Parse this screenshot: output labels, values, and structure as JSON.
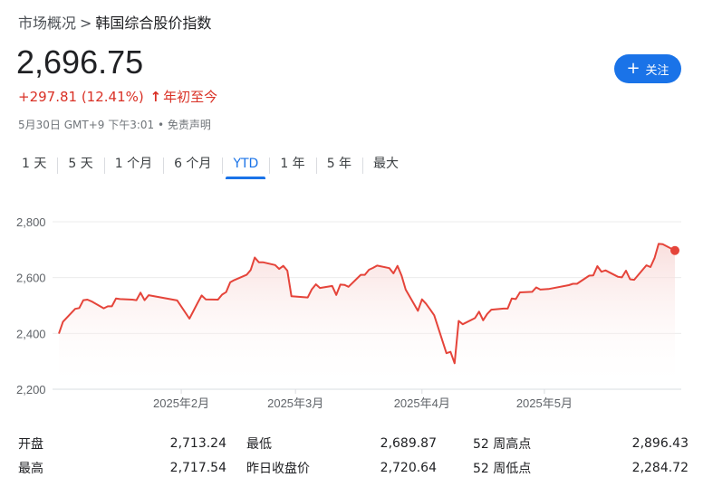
{
  "breadcrumb": {
    "parent": "市场概况",
    "separator": ">",
    "current": "韩国综合股价指数"
  },
  "price": "2,696.75",
  "change": {
    "text": "+297.81 (12.41%)",
    "arrow": "↑",
    "period": "年初至今",
    "color": "#d93025"
  },
  "meta": "5月30日 GMT+9 下午3:01 • 免责声明",
  "follow_button": {
    "icon": "plus-icon",
    "label": "关注",
    "color": "#1a73e8"
  },
  "range_tabs": [
    {
      "label": "1 天",
      "active": false
    },
    {
      "label": "5 天",
      "active": false
    },
    {
      "label": "1 个月",
      "active": false
    },
    {
      "label": "6 个月",
      "active": false
    },
    {
      "label": "YTD",
      "active": true
    },
    {
      "label": "1 年",
      "active": false
    },
    {
      "label": "5 年",
      "active": false
    },
    {
      "label": "最大",
      "active": false
    }
  ],
  "chart_data": {
    "type": "area",
    "x_tick_labels": [
      "2025年2月",
      "2025年3月",
      "2025年4月",
      "2025年5月"
    ],
    "y_ticks": [
      2200,
      2400,
      2600,
      2800
    ],
    "y_tick_labels": [
      "2,200",
      "2,400",
      "2,600",
      "2,800"
    ],
    "ylim": [
      2200,
      2800
    ],
    "x_range": [
      "2025-01-02",
      "2025-06-02"
    ],
    "grid": true,
    "line_color": "#e5443a",
    "fill_color": "#f7d4d2",
    "series": [
      {
        "x": [
          "2025-01-02",
          "2025-01-03",
          "2025-01-06",
          "2025-01-07",
          "2025-01-08",
          "2025-01-09",
          "2025-01-10",
          "2025-01-13",
          "2025-01-14",
          "2025-01-15",
          "2025-01-16",
          "2025-01-17",
          "2025-01-20",
          "2025-01-21",
          "2025-01-22",
          "2025-01-23",
          "2025-01-24",
          "2025-01-31",
          "2025-02-03",
          "2025-02-04",
          "2025-02-05",
          "2025-02-06",
          "2025-02-07",
          "2025-02-10",
          "2025-02-11",
          "2025-02-12",
          "2025-02-13",
          "2025-02-14",
          "2025-02-17",
          "2025-02-18",
          "2025-02-19",
          "2025-02-20",
          "2025-02-21",
          "2025-02-24",
          "2025-02-25",
          "2025-02-26",
          "2025-02-27",
          "2025-02-28",
          "2025-03-04",
          "2025-03-05",
          "2025-03-06",
          "2025-03-07",
          "2025-03-10",
          "2025-03-11",
          "2025-03-12",
          "2025-03-13",
          "2025-03-14",
          "2025-03-17",
          "2025-03-18",
          "2025-03-19",
          "2025-03-20",
          "2025-03-21",
          "2025-03-24",
          "2025-03-25",
          "2025-03-26",
          "2025-03-27",
          "2025-03-28",
          "2025-03-31",
          "2025-04-01",
          "2025-04-02",
          "2025-04-03",
          "2025-04-04",
          "2025-04-07",
          "2025-04-08",
          "2025-04-09",
          "2025-04-10",
          "2025-04-11",
          "2025-04-14",
          "2025-04-15",
          "2025-04-16",
          "2025-04-17",
          "2025-04-18",
          "2025-04-21",
          "2025-04-22",
          "2025-04-23",
          "2025-04-24",
          "2025-04-25",
          "2025-04-28",
          "2025-04-29",
          "2025-04-30",
          "2025-05-02",
          "2025-05-07",
          "2025-05-08",
          "2025-05-09",
          "2025-05-12",
          "2025-05-13",
          "2025-05-14",
          "2025-05-15",
          "2025-05-16",
          "2025-05-19",
          "2025-05-20",
          "2025-05-21",
          "2025-05-22",
          "2025-05-23",
          "2025-05-26",
          "2025-05-27",
          "2025-05-28",
          "2025-05-29",
          "2025-05-30",
          "2025-06-02"
        ],
        "values": [
          2399,
          2442,
          2488,
          2491,
          2519,
          2521,
          2515,
          2490,
          2497,
          2497,
          2525,
          2523,
          2521,
          2519,
          2546,
          2519,
          2537,
          2518,
          2453,
          2481,
          2509,
          2536,
          2522,
          2521,
          2539,
          2548,
          2583,
          2591,
          2610,
          2627,
          2672,
          2655,
          2655,
          2645,
          2631,
          2642,
          2625,
          2533,
          2529,
          2558,
          2576,
          2563,
          2570,
          2538,
          2575,
          2574,
          2567,
          2610,
          2610,
          2628,
          2635,
          2643,
          2634,
          2615,
          2642,
          2607,
          2557,
          2481,
          2522,
          2506,
          2486,
          2465,
          2329,
          2334,
          2293,
          2445,
          2433,
          2455,
          2478,
          2447,
          2470,
          2485,
          2489,
          2489,
          2525,
          2523,
          2547,
          2549,
          2565,
          2557,
          2559,
          2573,
          2578,
          2578,
          2607,
          2608,
          2641,
          2621,
          2626,
          2603,
          2601,
          2625,
          2594,
          2592,
          2644,
          2638,
          2670,
          2721,
          2720,
          2697
        ]
      }
    ]
  },
  "stats": {
    "open_label": "开盘",
    "open_value": "2,713.24",
    "high_label": "最高",
    "high_value": "2,717.54",
    "low_label": "最低",
    "low_value": "2,689.87",
    "prev_close_label": "昨日收盘价",
    "prev_close_value": "2,720.64",
    "wk52_high_label": "52 周高点",
    "wk52_high_value": "2,896.43",
    "wk52_low_label": "52 周低点",
    "wk52_low_value": "2,284.72"
  }
}
